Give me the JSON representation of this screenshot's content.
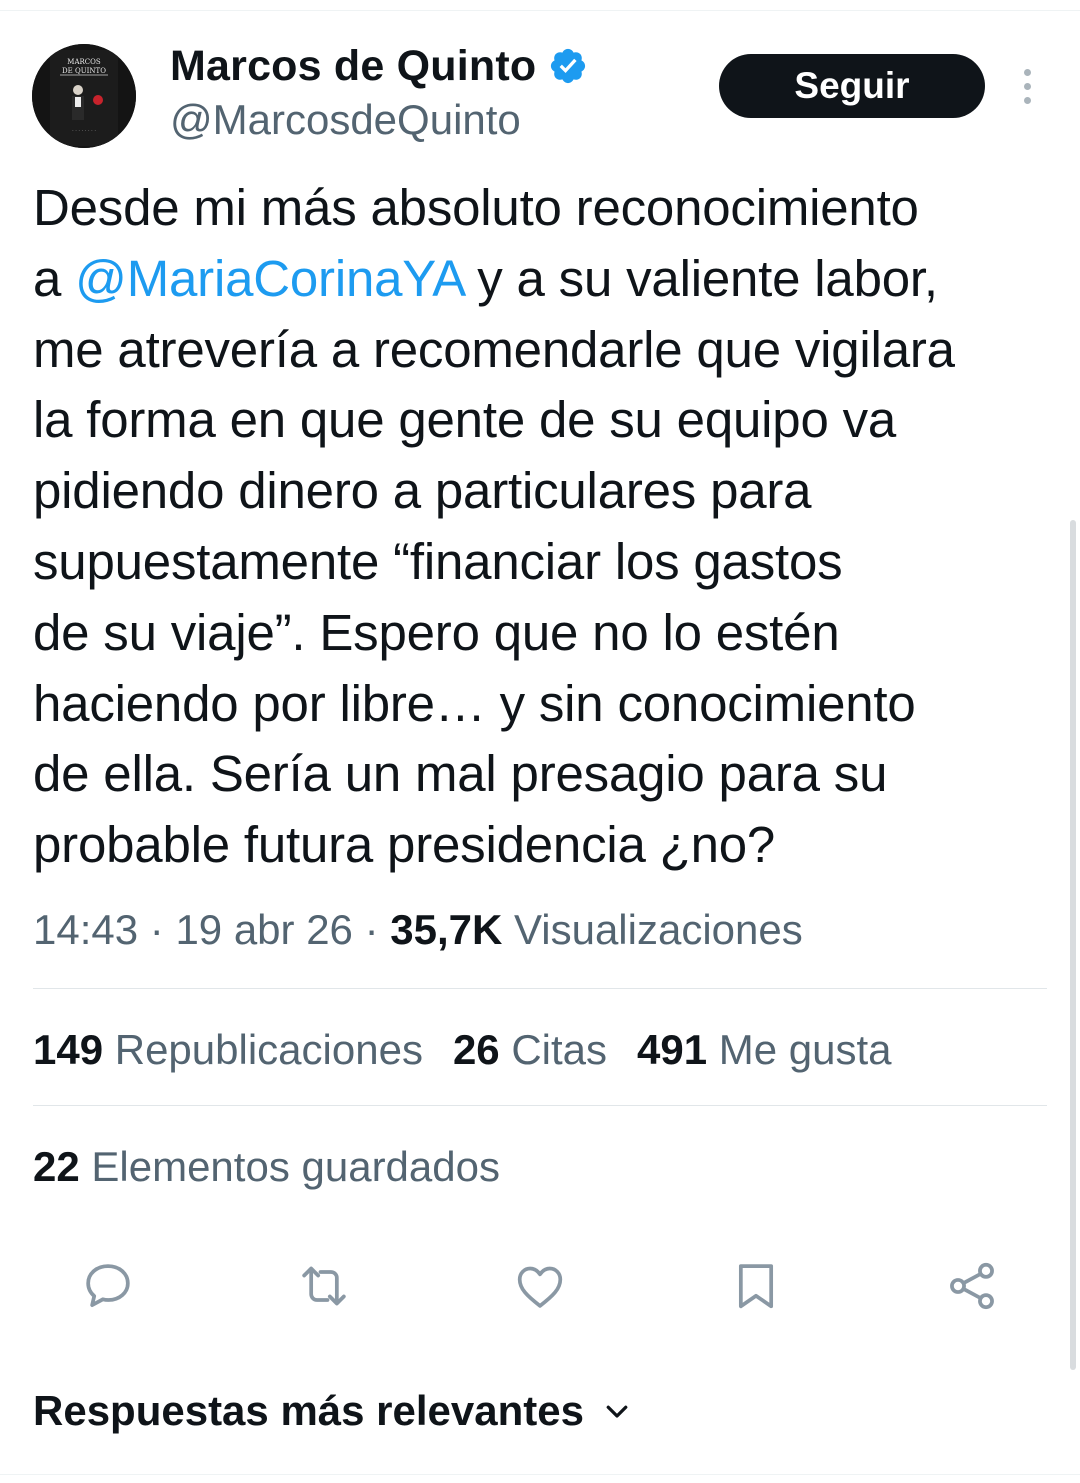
{
  "author": {
    "display_name": "Marcos de Quinto",
    "handle": "@MarcosdeQuinto",
    "verified": true,
    "avatar_cover_text": "MARCOS DE QUINTO"
  },
  "follow_label": "Seguir",
  "tweet": {
    "lines": [
      {
        "before": "Desde mi más absoluto reconocimiento",
        "mention": "",
        "after": ""
      },
      {
        "before": "a ",
        "mention": "@MariaCorinaYA",
        "after": " y a su valiente labor,"
      },
      {
        "before": "me atrevería a recomendarle que vigilara",
        "mention": "",
        "after": ""
      },
      {
        "before": "la forma en que gente de su equipo va",
        "mention": "",
        "after": ""
      },
      {
        "before": "pidiendo dinero a particulares para",
        "mention": "",
        "after": ""
      },
      {
        "before": "supuestamente “financiar los gastos",
        "mention": "",
        "after": ""
      },
      {
        "before": "de su viaje”. Espero que no lo estén",
        "mention": "",
        "after": ""
      },
      {
        "before": "haciendo por libre… y sin conocimiento",
        "mention": "",
        "after": ""
      },
      {
        "before": "de ella. Sería un mal presagio para su",
        "mention": "",
        "after": ""
      },
      {
        "before": "probable futura presidencia ¿no?",
        "mention": "",
        "after": ""
      }
    ]
  },
  "meta": {
    "time": "14:43",
    "separator": " · ",
    "date": "19 abr 26",
    "views_count": "35,7K",
    "views_label": " Visualizaciones"
  },
  "stats": {
    "reposts": {
      "count": "149",
      "label": " Republicaciones"
    },
    "quotes": {
      "count": "26",
      "label": " Citas"
    },
    "likes": {
      "count": "491",
      "label": " Me gusta"
    },
    "bookmarks": {
      "count": "22",
      "label": " Elementos guardados"
    }
  },
  "actions": [
    "reply-icon",
    "repost-icon",
    "like-icon",
    "bookmark-icon",
    "share-icon"
  ],
  "replies_sort_label": "Respuestas más relevantes",
  "colors": {
    "text": "#0f1419",
    "secondary": "#536471",
    "link": "#1d9bf0",
    "icon": "#8a98a4",
    "verified": "#1d9bf0"
  }
}
